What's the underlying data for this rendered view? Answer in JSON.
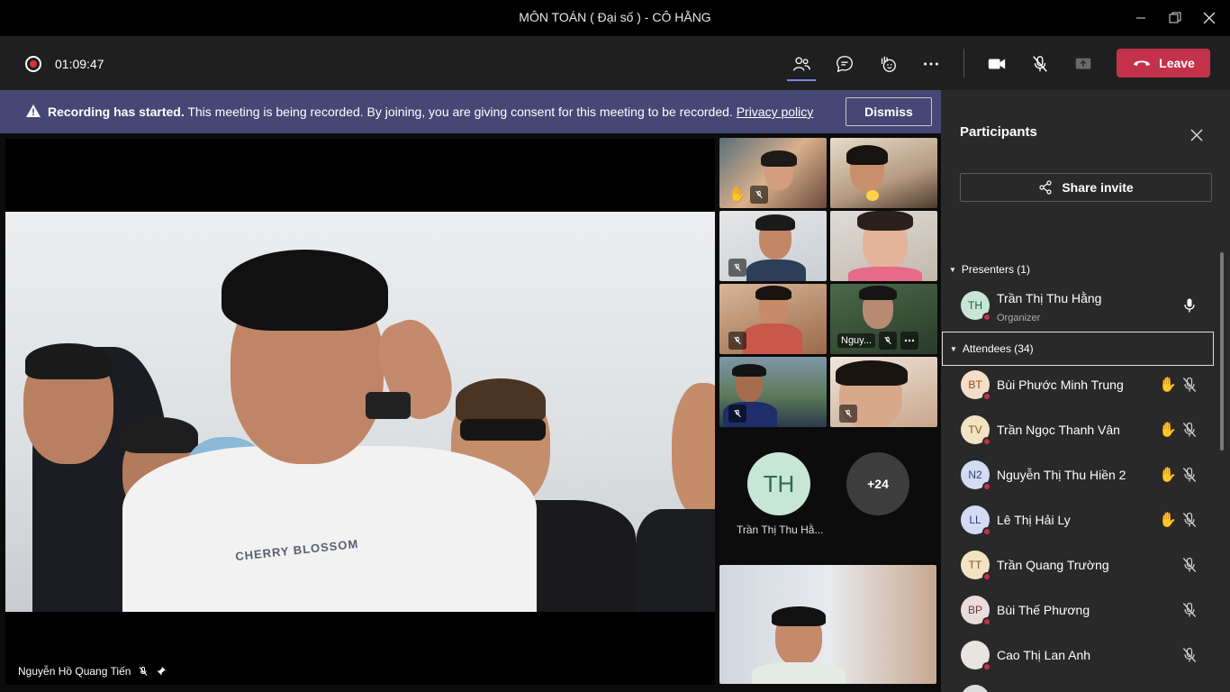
{
  "window": {
    "title": "MÔN TOÁN ( Đại số ) - CÔ HẰNG"
  },
  "toolbar": {
    "timer": "01:09:47",
    "leave_label": "Leave"
  },
  "banner": {
    "bold": "Recording has started.",
    "text": "This meeting is being recorded. By joining, you are giving consent for this meeting to be recorded.",
    "link": "Privacy policy",
    "dismiss_label": "Dismiss"
  },
  "stage": {
    "main_name": "Nguyễn Hồ Quang Tiến",
    "shirt_text": "CHERRY BLOSSOM",
    "tile_name": "Nguy...",
    "presenter_initials": "TH",
    "presenter_label": "Trần Thị Thu Hằ...",
    "more_count": "+24"
  },
  "panel": {
    "title": "Participants",
    "share_label": "Share invite",
    "presenters_header": "Presenters (1)",
    "attendees_header": "Attendees (34)",
    "presenters": [
      {
        "initials": "TH",
        "name": "Trần Thị Thu Hằng",
        "role": "Organizer",
        "color": "#c8e6d6",
        "fg": "#1e5a3c"
      }
    ],
    "attendees": [
      {
        "initials": "BT",
        "name": "Bùi Phước Minh Trung",
        "hand": true,
        "color": "#f6ddc8",
        "fg": "#8a4a1e"
      },
      {
        "initials": "TV",
        "name": "Trần Ngọc Thanh Vân",
        "hand": true,
        "color": "#f3e3c3",
        "fg": "#7a5a1e"
      },
      {
        "initials": "N2",
        "name": "Nguyễn Thị Thu Hiền 2",
        "hand": true,
        "color": "#d3dcf2",
        "fg": "#2d3f7a"
      },
      {
        "initials": "LL",
        "name": "Lê Thị Hải Ly",
        "hand": true,
        "color": "#d3dcf2",
        "fg": "#2d3f7a"
      },
      {
        "initials": "TT",
        "name": "Trần Quang Trường",
        "hand": false,
        "color": "#f3e3c3",
        "fg": "#7a5a1e"
      },
      {
        "initials": "BP",
        "name": "Bùi Thế Phương",
        "hand": false,
        "color": "#eadcdc",
        "fg": "#6a3a3a"
      },
      {
        "initials": "",
        "name": "Cao Thị Lan Anh",
        "hand": false,
        "color": "#e8e4e0",
        "fg": "#333"
      }
    ]
  },
  "colors": {
    "accent": "#7b83eb",
    "leave": "#c4314b",
    "banner": "#464775"
  }
}
